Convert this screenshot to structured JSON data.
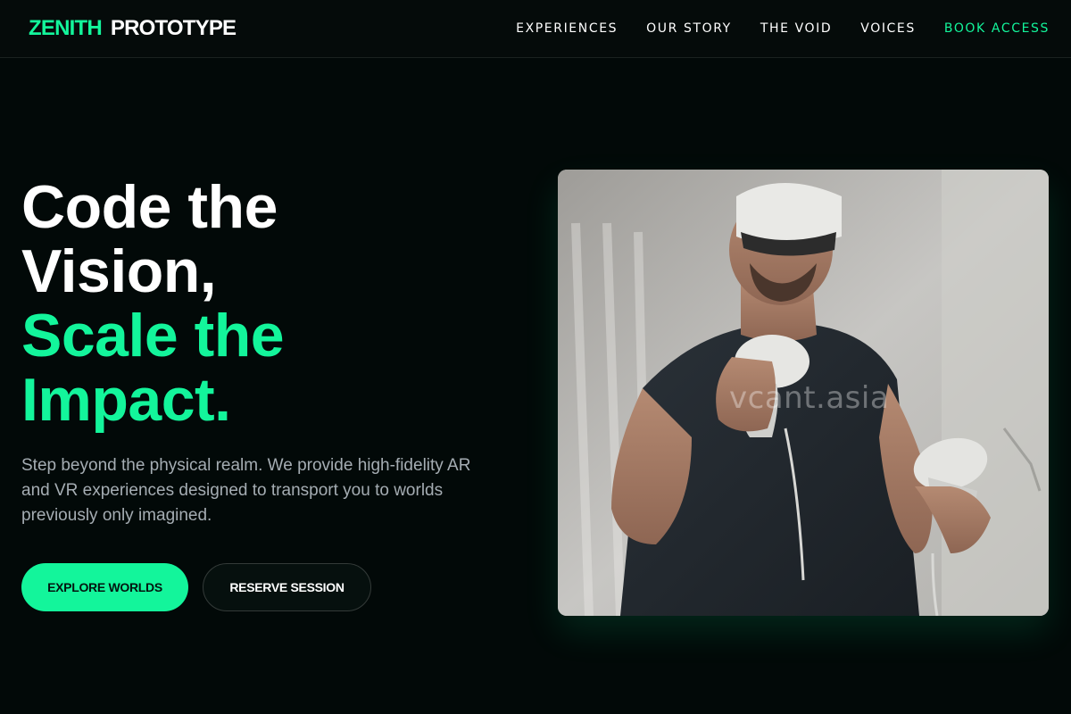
{
  "header": {
    "brand": "ZENITH",
    "brand_sub": "PROTOTYPE",
    "nav": [
      {
        "label": "EXPERIENCES"
      },
      {
        "label": "OUR STORY"
      },
      {
        "label": "THE VOID"
      },
      {
        "label": "VOICES"
      },
      {
        "label": "BOOK ACCESS"
      }
    ]
  },
  "hero": {
    "title_lines": [
      "Code the",
      "Vision,",
      "Scale the",
      "Impact."
    ],
    "description": "Step beyond the physical realm. We provide high-fidelity AR and VR experiences designed to transport you to worlds previously only imagined.",
    "primary_button": "EXPLORE WORLDS",
    "secondary_button": "RESERVE SESSION",
    "image": {
      "subject": "person wearing VR headset holding controllers",
      "watermark": "vcant.asia"
    }
  },
  "colors": {
    "accent": "#13f59b",
    "background": "#020908",
    "text_muted": "#a5adb3"
  }
}
